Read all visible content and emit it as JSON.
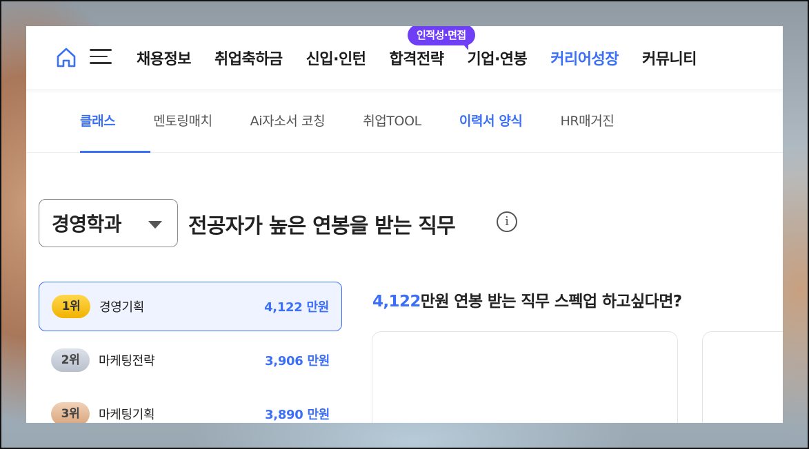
{
  "nav": {
    "badge": "인적성·면접",
    "items": [
      {
        "label": "채용정보"
      },
      {
        "label": "취업축하금"
      },
      {
        "label": "신입·인턴"
      },
      {
        "label": "합격전략"
      },
      {
        "label": "기업·연봉"
      },
      {
        "label": "커리어성장",
        "active": true
      },
      {
        "label": "커뮤니티"
      }
    ]
  },
  "subnav": {
    "items": [
      {
        "label": "클래스",
        "active": true
      },
      {
        "label": "멘토링매치"
      },
      {
        "label": "Ai자소서 코칭"
      },
      {
        "label": "취업TOOL"
      },
      {
        "label": "이력서 양식"
      },
      {
        "label": "HR매거진"
      }
    ]
  },
  "heading": {
    "major": "경영학과",
    "title": "전공자가 높은 연봉을 받는 직무",
    "info": "i"
  },
  "ranking": [
    {
      "rank": "1위",
      "job": "경영기획",
      "salary": "4,122 만원"
    },
    {
      "rank": "2위",
      "job": "마케팅전략",
      "salary": "3,906 만원"
    },
    {
      "rank": "3위",
      "job": "마케팅기획",
      "salary": "3,890 만원"
    }
  ],
  "promo": {
    "amount": "4,122",
    "text": "만원 연봉 받는 직무 스펙업 하고싶다면?"
  },
  "colors": {
    "accent": "#3b6ff5",
    "badge": "#6f3ff5"
  }
}
